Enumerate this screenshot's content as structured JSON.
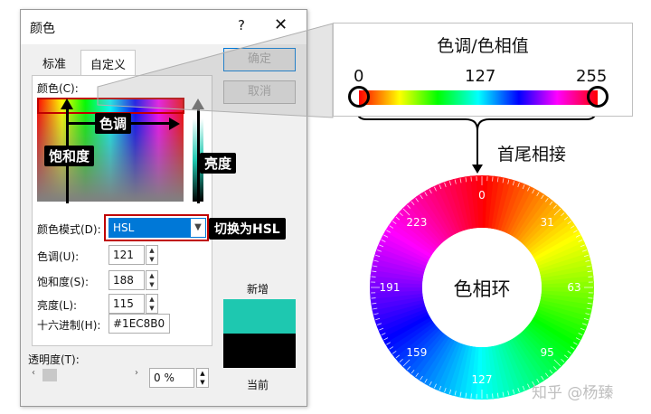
{
  "dialog": {
    "title": "颜色",
    "help_label": "?",
    "close_label": "✕",
    "tabs": [
      {
        "label": "标准"
      },
      {
        "label": "自定义"
      }
    ],
    "ok_label": "确定",
    "cancel_label": "取消",
    "color_label": "颜色(C):",
    "mode_label": "颜色模式(D):",
    "mode_value": "HSL",
    "fields": [
      {
        "label": "色调(U):",
        "value": "121"
      },
      {
        "label": "饱和度(S):",
        "value": "188"
      },
      {
        "label": "亮度(L):",
        "value": "115"
      }
    ],
    "hex_label": "十六进制(H):",
    "hex_value": "#1EC8B0",
    "new_label": "新增",
    "current_label": "当前",
    "new_color": "#1EC8B0",
    "current_color": "#000000",
    "opacity_label": "透明度(T):",
    "opacity_value": "0 %"
  },
  "annotations": {
    "hue_tag": "色调",
    "saturation_tag": "饱和度",
    "luminance_tag": "亮度",
    "hsl_tag": "切换为HSL"
  },
  "zoom": {
    "title": "色调/色相值",
    "scale_labels": [
      "0",
      "127",
      "255"
    ],
    "join_label": "首尾相接"
  },
  "wheel": {
    "center_label": "色相环",
    "tick_labels": [
      "0",
      "31",
      "63",
      "95",
      "127",
      "159",
      "191",
      "223"
    ]
  },
  "watermark": "知乎 @杨臻",
  "colors": {
    "highlight": "#c00000",
    "accent": "#0078d7"
  }
}
